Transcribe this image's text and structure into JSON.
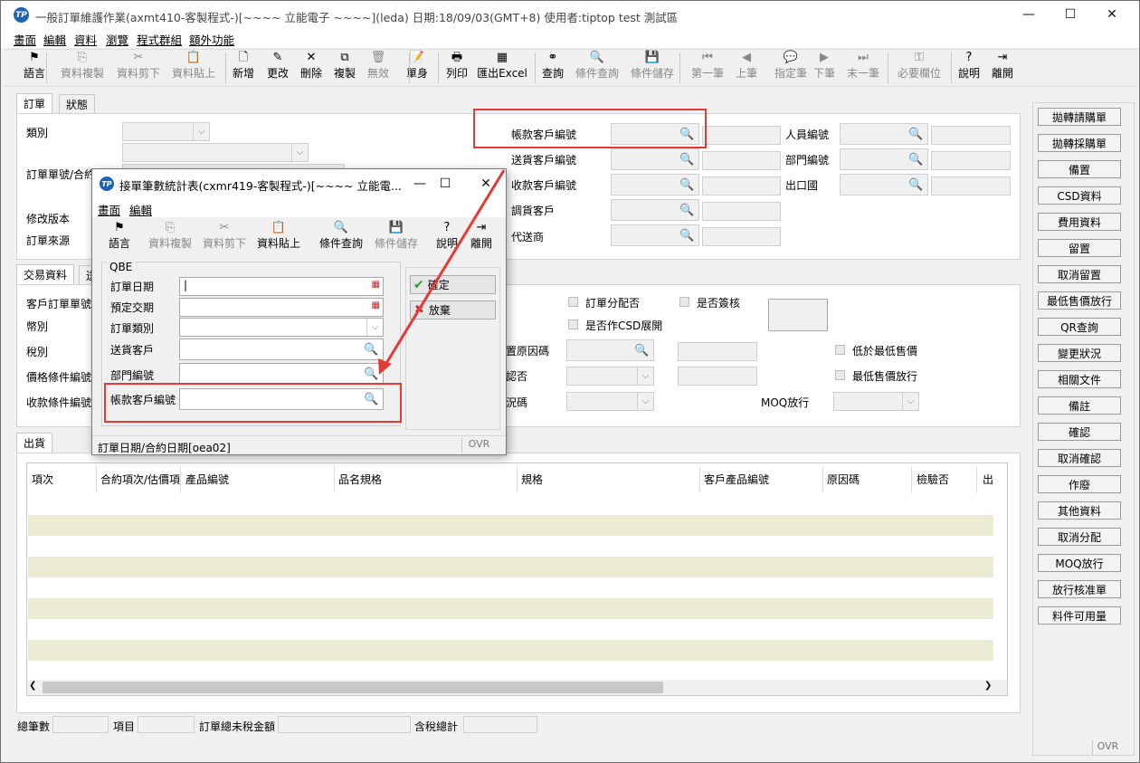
{
  "window": {
    "title": "一般訂單維護作業(axmt410-客製程式-)[~~~~ 立能電子 ~~~~](leda)  日期:18/09/03(GMT+8)  使用者:tiptop test 測試區",
    "logo": "TP",
    "minimize": "—",
    "maximize": "☐",
    "close": "✕"
  },
  "menu": [
    "畫面",
    "編輯",
    "資料",
    "瀏覽",
    "程式群組",
    "額外功能"
  ],
  "toolbar": [
    {
      "label": "語言",
      "icon": "flag-icon"
    },
    {
      "label": "資料複製",
      "icon": "copy-icon"
    },
    {
      "label": "資料剪下",
      "icon": "scissors-icon"
    },
    {
      "label": "資料貼上",
      "icon": "paste-icon"
    },
    {
      "label": "新增",
      "icon": "new-icon"
    },
    {
      "label": "更改",
      "icon": "edit-icon"
    },
    {
      "label": "刪除",
      "icon": "delete-icon"
    },
    {
      "label": "複製",
      "icon": "duplicate-icon"
    },
    {
      "label": "無效",
      "icon": "trash-icon"
    },
    {
      "label": "單身",
      "icon": "detail-icon"
    },
    {
      "label": "列印",
      "icon": "print-icon"
    },
    {
      "label": "匯出Excel",
      "icon": "excel-icon"
    },
    {
      "label": "查詢",
      "icon": "binoculars-icon"
    },
    {
      "label": "條件查詢",
      "icon": "query-icon"
    },
    {
      "label": "條件儲存",
      "icon": "save-query-icon"
    },
    {
      "label": "第一筆",
      "icon": "first-icon"
    },
    {
      "label": "上筆",
      "icon": "prev-icon"
    },
    {
      "label": "指定筆",
      "icon": "goto-icon"
    },
    {
      "label": "下筆",
      "icon": "next-icon"
    },
    {
      "label": "末一筆",
      "icon": "last-icon"
    },
    {
      "label": "必要欄位",
      "icon": "key-icon"
    },
    {
      "label": "說明",
      "icon": "help-icon"
    },
    {
      "label": "離開",
      "icon": "exit-icon"
    }
  ],
  "tabs_top": [
    "訂單",
    "狀態"
  ],
  "header_labels": {
    "type": "類別",
    "order_no": "訂單單號/合約單號",
    "version": "修改版本",
    "source": "訂單來源"
  },
  "header_right": {
    "bill_cust": "帳款客戶編號",
    "ship_cust": "送貨客戶編號",
    "pay_cust": "收款客戶編號",
    "transfer_cust": "調貨客戶",
    "agent": "代送商",
    "emp": "人員編號",
    "dept": "部門編號",
    "export": "出口國"
  },
  "tabs_mid": [
    "交易資料",
    "送"
  ],
  "trade_labels": {
    "cust_order": "客戶訂單單號",
    "currency": "幣別",
    "tax": "稅別",
    "price_cond": "價格條件編號",
    "pay_cond": "收款條件編號"
  },
  "trade_right": {
    "alloc": "訂單分配否",
    "signed": "是否簽核",
    "csd": "是否作CSD展開",
    "reason_code": "留置原因碼",
    "confirm": "確認否",
    "status_code": "狀況碼",
    "moq": "MOQ放行",
    "below_min": "低於最低售價",
    "min_release": "最低售價放行"
  },
  "tabs_bottom": [
    "出貨"
  ],
  "grid_headers": [
    "項次",
    "合約項次/估價項",
    "產品編號",
    "品名規格",
    "規格",
    "客戶產品編號",
    "原因碼",
    "檢驗否",
    "出"
  ],
  "footer": {
    "total_count": "總筆數",
    "item": "項目",
    "untaxed": "訂單總未稅金額",
    "taxed": "含稅總計",
    "ovr": "OVR"
  },
  "side_buttons": [
    "拋轉請購單",
    "拋轉採購單",
    "備置",
    "CSD資料",
    "費用資料",
    "留置",
    "取消留置",
    "最低售價放行",
    "QR查詢",
    "變更狀況",
    "相關文件",
    "備註",
    "確認",
    "取消確認",
    "作廢",
    "其他資料",
    "取消分配",
    "MOQ放行",
    "放行核准單",
    "料件可用量"
  ],
  "dialog": {
    "title": "接單筆數統計表(cxmr419-客製程式-)[~~~~ 立能電...",
    "menu": [
      "畫面",
      "編輯"
    ],
    "toolbar": [
      {
        "label": "語言",
        "icon": "flag-icon"
      },
      {
        "label": "資料複製",
        "icon": "copy-icon"
      },
      {
        "label": "資料剪下",
        "icon": "scissors-icon"
      },
      {
        "label": "資料貼上",
        "icon": "paste-icon"
      },
      {
        "label": "條件查詢",
        "icon": "query-icon"
      },
      {
        "label": "條件儲存",
        "icon": "save-query-icon"
      },
      {
        "label": "說明",
        "icon": "help-icon"
      },
      {
        "label": "離開",
        "icon": "exit-icon"
      }
    ],
    "group": "QBE",
    "fields": [
      "訂單日期",
      "預定交期",
      "訂單類別",
      "送貨客戶",
      "部門編號",
      "帳款客戶編號"
    ],
    "ok": "確定",
    "cancel": "放棄",
    "status": "訂單日期/合約日期[oea02]",
    "ovr": "OVR"
  },
  "colors": {
    "highlight": "#e53935",
    "stripe": "#ecebd3",
    "accent": "#1c63b7"
  }
}
